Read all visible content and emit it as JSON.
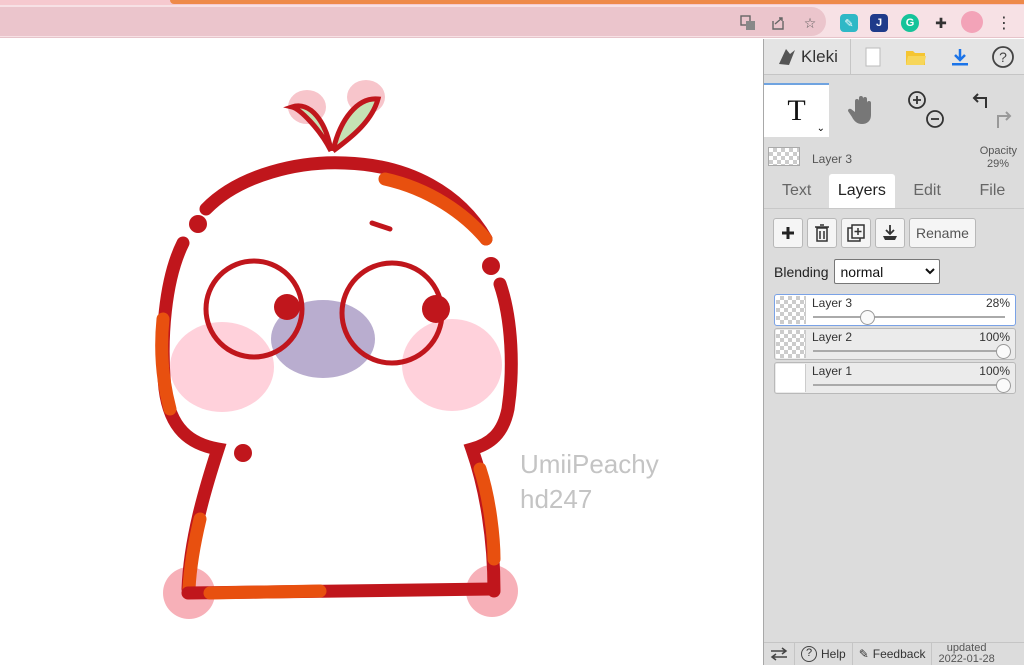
{
  "browser": {
    "toolbar_icons": [
      "translate-icon",
      "share-icon",
      "star-icon"
    ],
    "extensions": [
      "extension-feather-icon",
      "extension-j-icon",
      "grammarly-icon",
      "puzzle-icon",
      "profile-avatar",
      "more-icon"
    ]
  },
  "canvas": {
    "watermark_line1": "UmiiPeachy",
    "watermark_line2": "hd247"
  },
  "app": {
    "logo_text": "Kleki",
    "top_buttons": [
      "new-image-icon",
      "open-folder-icon",
      "download-icon",
      "help-icon"
    ],
    "tool_active_label": "T",
    "current_layer": {
      "name": "Layer 3",
      "opacity_label": "Opacity",
      "opacity_value": "29%"
    },
    "tabs": [
      {
        "label": "Text",
        "active": false
      },
      {
        "label": "Layers",
        "active": true
      },
      {
        "label": "Edit",
        "active": false
      },
      {
        "label": "File",
        "active": false
      }
    ],
    "layer_buttons": {
      "rename_label": "Rename"
    },
    "blending": {
      "label": "Blending",
      "value": "normal"
    },
    "layers": [
      {
        "name": "Layer 3",
        "opacity": "28%",
        "opacity_value": 0.28,
        "selected": true
      },
      {
        "name": "Layer 2",
        "opacity": "100%",
        "opacity_value": 1.0,
        "selected": false
      },
      {
        "name": "Layer 1",
        "opacity": "100%",
        "opacity_value": 1.0,
        "selected": false
      }
    ],
    "bottom": {
      "help_label": "Help",
      "feedback_label": "Feedback",
      "updated_label": "updated",
      "updated_date": "2022-01-28"
    }
  },
  "colors": {
    "accent_blue": "#6fa3e0",
    "stroke_red": "#c0161c",
    "stroke_orange": "#e8500f",
    "blush_pink": "#ffb6c6",
    "nose_purple": "#b5a6cf"
  }
}
